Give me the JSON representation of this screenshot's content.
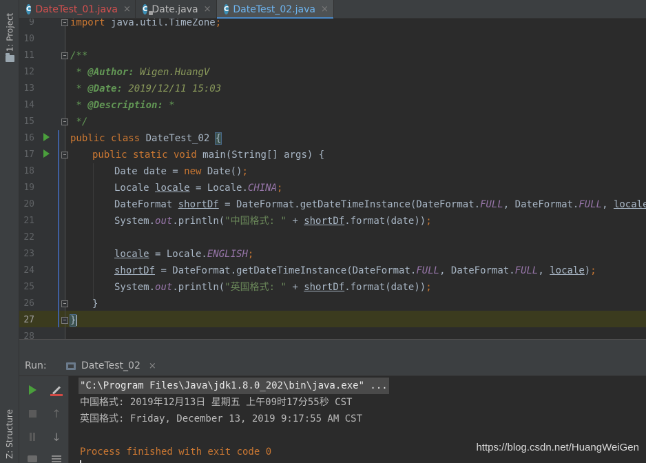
{
  "left_strip": {
    "project_tab": "1: Project",
    "structure_tab": "Z: Structure"
  },
  "tabs": [
    {
      "label": "DateTest_01.java",
      "icon": "java-class-icon",
      "color": "#d6504f"
    },
    {
      "label": "Date.java",
      "icon": "java-class-locked-icon",
      "color": "#bbbbbb"
    },
    {
      "label": "DateTest_02.java",
      "icon": "java-class-icon",
      "color": "#6eb5f0",
      "active": true
    }
  ],
  "close_glyph": "×",
  "editor": {
    "line_numbers": [
      "9",
      "10",
      "11",
      "12",
      "13",
      "14",
      "15",
      "16",
      "17",
      "18",
      "19",
      "20",
      "21",
      "22",
      "23",
      "24",
      "25",
      "26",
      "27",
      "28"
    ],
    "code": {
      "l9": {
        "kw": "import ",
        "rest": "java.util.TimeZone",
        "semi": ";"
      },
      "l11": "/**",
      "l12": {
        "star": " * ",
        "tag": "@Author:",
        "val": " Wigen.HuangV"
      },
      "l13": {
        "star": " * ",
        "tag": "@Date:",
        "val": " 2019/12/11 15:03"
      },
      "l14": {
        "star": " * ",
        "tag": "@Description:",
        "val": " *"
      },
      "l15": " */",
      "l16": {
        "kw": "public class ",
        "name": "DateTest_02 ",
        "brace": "{"
      },
      "l17": {
        "kw": "public static void ",
        "rest": "main(String[] args) {"
      },
      "l18": {
        "a": "Date ",
        "b": "date",
        "c": " = ",
        "kw": "new ",
        "d": "Date()",
        "semi": ";"
      },
      "l19": {
        "a": "Locale ",
        "b": "locale",
        "c": " = Locale.",
        "cst": "CHINA",
        "semi": ";"
      },
      "l20": {
        "a": "DateFormat ",
        "b": "shortDf",
        "c": " = DateFormat.",
        "m": "getDateTimeInstance",
        "d": "(DateFormat.",
        "cst1": "FULL",
        "e": ", DateFormat.",
        "cst2": "FULL",
        "f": ", ",
        "g": "locale",
        "h": ")",
        "semi": ";"
      },
      "l21": {
        "a": "System.",
        "fld": "out",
        "b": ".println(",
        "str": "\"中国格式: \"",
        "c": " + ",
        "d": "shortDf",
        "e": ".format(date))",
        "semi": ";"
      },
      "l23": {
        "a": "locale",
        "c": " = Locale.",
        "cst": "ENGLISH",
        "semi": ";"
      },
      "l24": {
        "a": "shortDf",
        "c": " = DateFormat.",
        "m": "getDateTimeInstance",
        "d": "(DateFormat.",
        "cst1": "FULL",
        "e": ", DateFormat.",
        "cst2": "FULL",
        "f": ", ",
        "g": "locale",
        "h": ")",
        "semi": ";"
      },
      "l25": {
        "a": "System.",
        "fld": "out",
        "b": ".println(",
        "str": "\"英国格式: \"",
        "c": " + ",
        "d": "shortDf",
        "e": ".format(date))",
        "semi": ";"
      },
      "l26": "}",
      "l27": "}"
    }
  },
  "run": {
    "label": "Run:",
    "tab": "DateTest_02",
    "console": [
      "\"C:\\Program Files\\Java\\jdk1.8.0_202\\bin\\java.exe\" ...",
      "中国格式: 2019年12月13日 星期五 上午09时17分55秒 CST",
      "英国格式: Friday, December 13, 2019 9:17:55 AM CST",
      "",
      "Process finished with exit code 0"
    ]
  },
  "watermark": "https://blog.csdn.net/HuangWeiGen",
  "colors": {
    "keyword": "#cc7832",
    "string": "#6a8759",
    "constant": "#9876aa",
    "doc": "#629755",
    "current_line": "#3b3b1e"
  }
}
